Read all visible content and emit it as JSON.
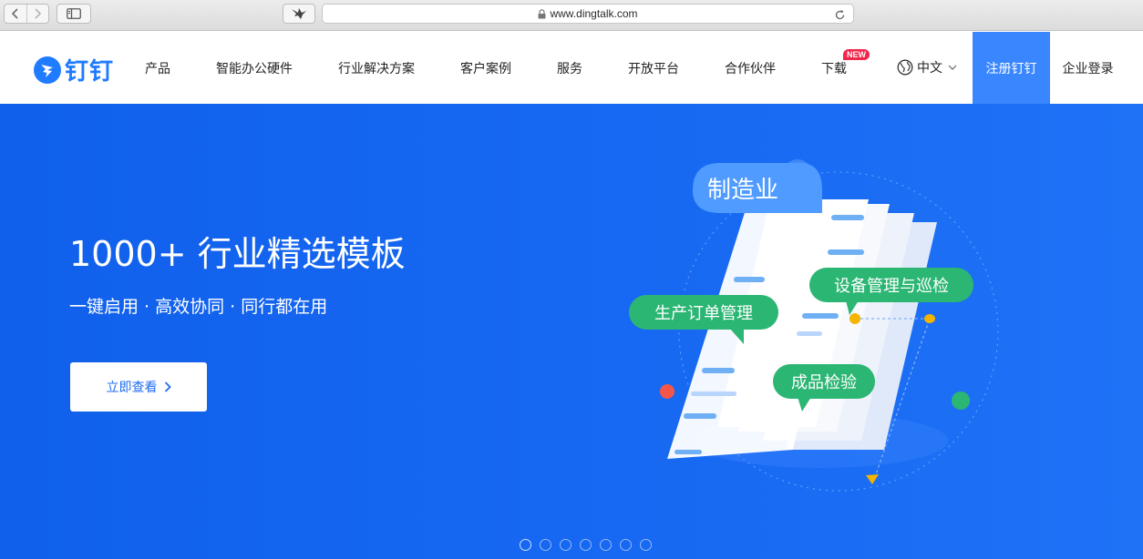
{
  "browser": {
    "url": "www.dingtalk.com"
  },
  "header": {
    "logo_text": "钉钉",
    "nav": [
      "产品",
      "智能办公硬件",
      "行业解决方案",
      "客户案例",
      "服务",
      "开放平台",
      "合作伙伴",
      "下载"
    ],
    "new_badge": "NEW",
    "language": "中文",
    "register_label": "注册钉钉",
    "login_label": "企业登录"
  },
  "hero": {
    "title": "1000+ 行业精选模板",
    "subtitle": "一键启用 · 高效协同 · 同行都在用",
    "cta_label": "立即查看",
    "bubbles": {
      "top": "制造业",
      "right": "设备管理与巡检",
      "left": "生产订单管理",
      "bottom": "成品检验"
    },
    "carousel_dots": 7,
    "active_dot": 0
  },
  "colors": {
    "brand_blue": "#1f7bff",
    "hero_blue": "#1566f0",
    "register_bg": "#3a86ff",
    "bubble_green": "#2cb673",
    "new_badge": "#f0264a"
  },
  "icons": {
    "back": "chevron-left-icon",
    "forward": "chevron-right-icon",
    "sidebar": "sidebar-icon",
    "bird": "bird-icon",
    "lock": "lock-icon",
    "reload": "reload-icon",
    "globe": "globe-icon",
    "chevron": "chevron-down-icon"
  }
}
